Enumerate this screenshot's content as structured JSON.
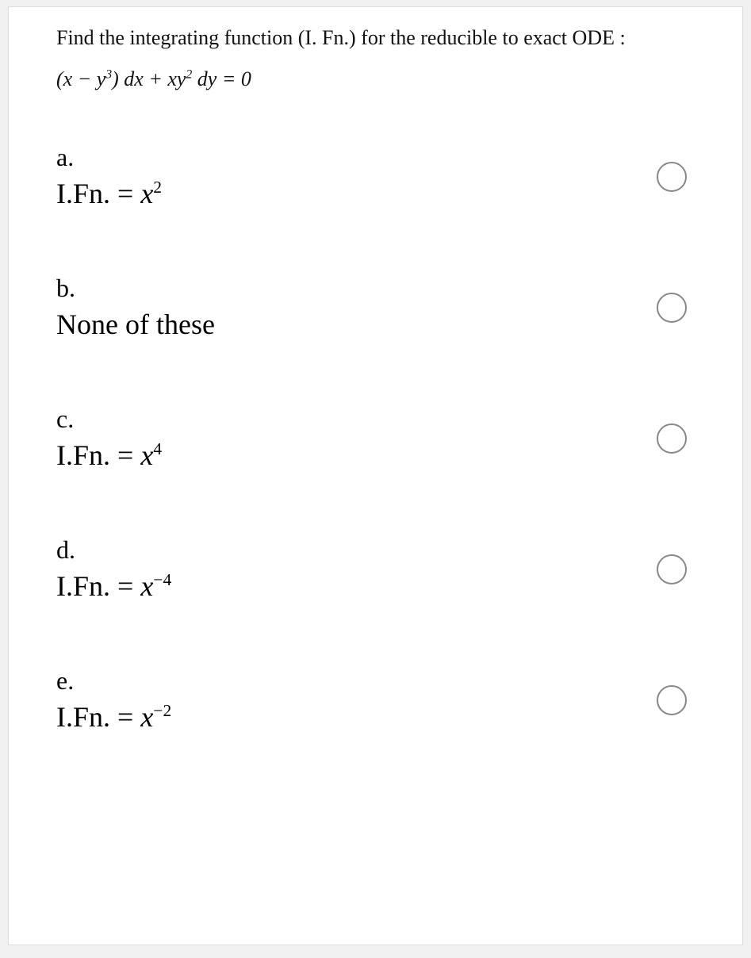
{
  "question": {
    "prompt": "Find the integrating function (I. Fn.) for the reducible to exact  ODE :",
    "equation_plain": "(x − y³) dx + xy² dy = 0"
  },
  "options": {
    "a": {
      "label": "a.",
      "text_plain": "I.Fn. = x²",
      "prefix": "I.Fn. = ",
      "base": "x",
      "exp": "2"
    },
    "b": {
      "label": "b.",
      "text_plain": "None of these",
      "full": "None of these"
    },
    "c": {
      "label": "c.",
      "text_plain": "I.Fn. = x⁴",
      "prefix": "I.Fn. = ",
      "base": "x",
      "exp": "4"
    },
    "d": {
      "label": "d.",
      "text_plain": "I.Fn. = x⁻⁴",
      "prefix": "I.Fn. = ",
      "base": "x",
      "exp": "−4"
    },
    "e": {
      "label": "e.",
      "text_plain": "I.Fn. = x⁻²",
      "prefix": "I.Fn. = ",
      "base": "x",
      "exp": "−2"
    }
  }
}
